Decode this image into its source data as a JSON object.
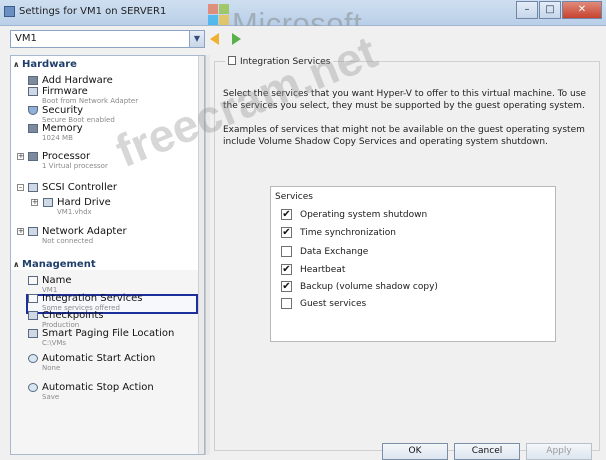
{
  "window": {
    "title": "Settings for VM1 on SERVER1"
  },
  "logo": {
    "text": "Microsoft",
    "colors": [
      "#f25022",
      "#7fba00",
      "#00a4ef",
      "#ffb900"
    ]
  },
  "vm_selector": {
    "value": "VM1"
  },
  "sidebar": {
    "hardware_header": "Hardware",
    "hardware": [
      {
        "label": "Add Hardware",
        "sub": ""
      },
      {
        "label": "Firmware",
        "sub": "Boot from Network Adapter"
      },
      {
        "label": "Security",
        "sub": "Secure Boot enabled"
      },
      {
        "label": "Memory",
        "sub": "1024 MB"
      },
      {
        "label": "Processor",
        "sub": "1 Virtual processor"
      },
      {
        "label": "SCSI Controller",
        "sub": ""
      },
      {
        "label": "Hard Drive",
        "sub": "VM1.vhdx"
      },
      {
        "label": "Network Adapter",
        "sub": "Not connected"
      }
    ],
    "management_header": "Management",
    "management": [
      {
        "label": "Name",
        "sub": "VM1"
      },
      {
        "label": "Integration Services",
        "sub": "Some services offered"
      },
      {
        "label": "Checkpoints",
        "sub": "Production"
      },
      {
        "label": "Smart Paging File Location",
        "sub": "C:\\VMs"
      },
      {
        "label": "Automatic Start Action",
        "sub": "None"
      },
      {
        "label": "Automatic Stop Action",
        "sub": "Save"
      }
    ]
  },
  "panel": {
    "title": "Integration Services",
    "description": "Select the services that you want Hyper-V to offer to this virtual machine. To use the services you select, they must be supported by the guest operating system.",
    "examples": "Examples of services that might not be available on the guest operating system include Volume Shadow Copy Services and operating system shutdown.",
    "services_label": "Services",
    "services": [
      {
        "label": "Operating system shutdown",
        "checked": true
      },
      {
        "label": "Time synchronization",
        "checked": true
      },
      {
        "label": "Data Exchange",
        "checked": false
      },
      {
        "label": "Heartbeat",
        "checked": true
      },
      {
        "label": "Backup (volume shadow copy)",
        "checked": true
      },
      {
        "label": "Guest services",
        "checked": false
      }
    ]
  },
  "buttons": {
    "ok": "OK",
    "cancel": "Cancel",
    "apply": "Apply"
  },
  "watermark": "freecram.net"
}
